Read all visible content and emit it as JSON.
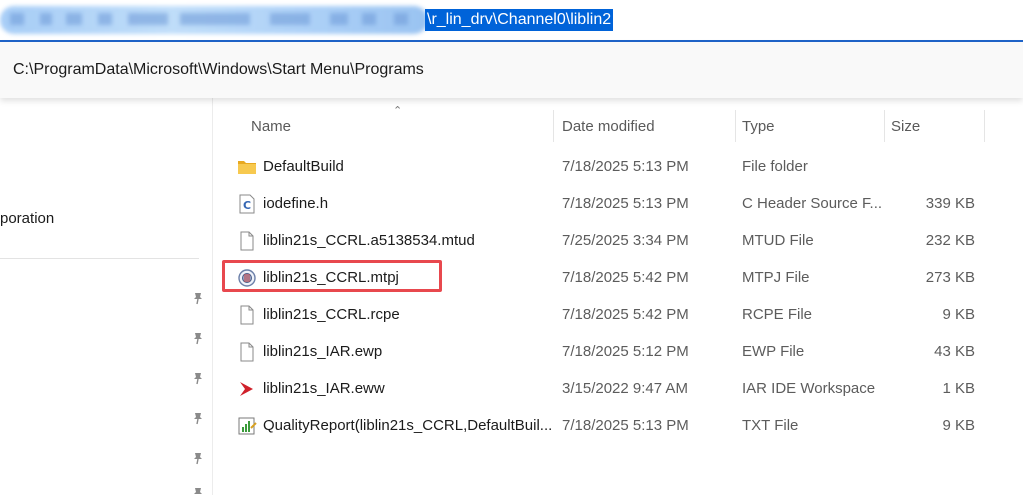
{
  "address_bar": {
    "visible_path_tail": "\\r_lin_drv\\Channel0\\liblin2"
  },
  "suggestion": {
    "item": "C:\\ProgramData\\Microsoft\\Windows\\Start Menu\\Programs"
  },
  "nav": {
    "partial_item": "poration",
    "pins": [
      "pin-icon",
      "pin-icon",
      "pin-icon",
      "pin-icon",
      "pin-icon",
      "pin-icon"
    ]
  },
  "columns": {
    "name": "Name",
    "date": "Date modified",
    "type": "Type",
    "size": "Size"
  },
  "files": [
    {
      "name": "DefaultBuild",
      "date": "7/18/2025 5:13 PM",
      "type": "File folder",
      "size": "",
      "icon": "folder-icon"
    },
    {
      "name": "iodefine.h",
      "date": "7/18/2025 5:13 PM",
      "type": "C Header Source F...",
      "size": "339 KB",
      "icon": "c-header-icon"
    },
    {
      "name": "liblin21s_CCRL.a5138534.mtud",
      "date": "7/25/2025 3:34 PM",
      "type": "MTUD File",
      "size": "232 KB",
      "icon": "file-icon"
    },
    {
      "name": "liblin21s_CCRL.mtpj",
      "date": "7/18/2025 5:42 PM",
      "type": "MTPJ File",
      "size": "273 KB",
      "icon": "mtpj-icon"
    },
    {
      "name": "liblin21s_CCRL.rcpe",
      "date": "7/18/2025 5:42 PM",
      "type": "RCPE File",
      "size": "9 KB",
      "icon": "file-icon"
    },
    {
      "name": "liblin21s_IAR.ewp",
      "date": "7/18/2025 5:12 PM",
      "type": "EWP File",
      "size": "43 KB",
      "icon": "file-icon"
    },
    {
      "name": "liblin21s_IAR.eww",
      "date": "3/15/2022 9:47 AM",
      "type": "IAR IDE Workspace",
      "size": "1 KB",
      "icon": "iar-icon"
    },
    {
      "name": "QualityReport(liblin21s_CCRL,DefaultBuil...",
      "date": "7/18/2025 5:13 PM",
      "type": "TXT File",
      "size": "9 KB",
      "icon": "report-icon"
    }
  ],
  "colors": {
    "selection": "#0063d9",
    "highlight": "#e8484e",
    "folder": "#f4c54a"
  }
}
